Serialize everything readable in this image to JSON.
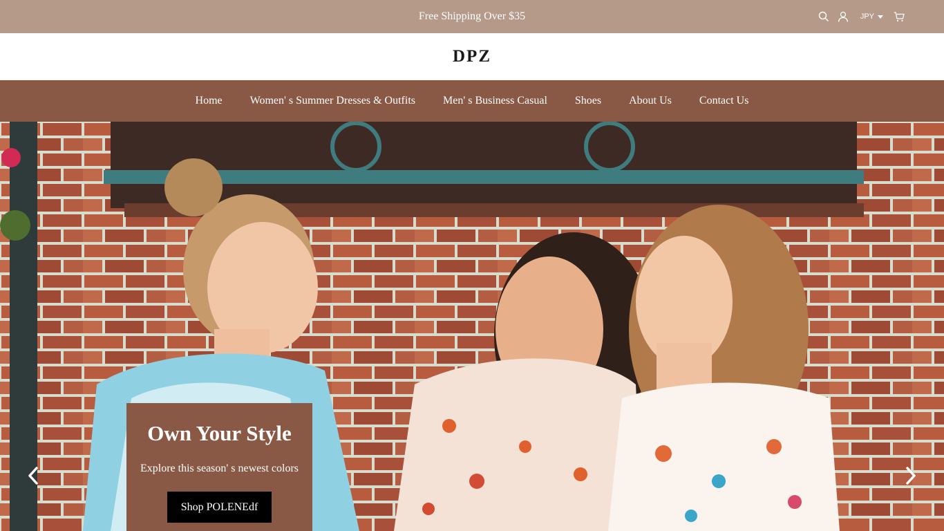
{
  "announcement": {
    "text": "Free Shipping Over $35"
  },
  "header_icons": {
    "search": "search-icon",
    "account": "user-icon",
    "currency": "JPY",
    "cart": "cart-icon"
  },
  "brand": {
    "logo": "DPZ"
  },
  "nav": {
    "items": [
      {
        "label": "Home"
      },
      {
        "label": "Women' s Summer Dresses & Outfits"
      },
      {
        "label": "Men' s Business Casual"
      },
      {
        "label": "Shoes"
      },
      {
        "label": "About Us"
      },
      {
        "label": "Contact Us"
      }
    ]
  },
  "hero": {
    "title": "Own Your Style",
    "subtitle": "Explore this season' s newest colors",
    "cta": "Shop POLENEdf",
    "prev_icon": "chevron-left-icon",
    "next_icon": "chevron-right-icon"
  },
  "colors": {
    "topbar": "#b59a89",
    "nav": "#8a5945",
    "promo_box": "#8a5945",
    "button": "#000000",
    "text_light": "#ffffff",
    "logo_text": "#1a1a1a"
  }
}
